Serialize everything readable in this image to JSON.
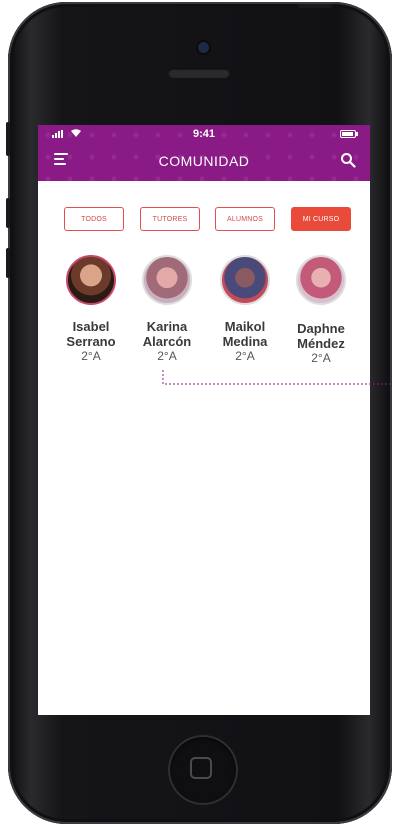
{
  "status_bar": {
    "time": "9:41"
  },
  "header": {
    "title": "COMUNIDAD",
    "menu_icon": "hamburger-menu-icon",
    "search_icon": "search-icon",
    "color": "#8a1a86"
  },
  "filters": [
    {
      "label": "TODOS",
      "active": false
    },
    {
      "label": "TUTORES",
      "active": false
    },
    {
      "label": "ALUMNOS",
      "active": false
    },
    {
      "label": "MI CURSO",
      "active": true
    }
  ],
  "members": [
    {
      "first": "Isabel",
      "last": "Serrano",
      "grade": "2°A"
    },
    {
      "first": "Karina",
      "last": "Alarcón",
      "grade": "2°A"
    },
    {
      "first": "Maikol",
      "last": "Medina",
      "grade": "2°A"
    },
    {
      "first": "Daphne",
      "last": "Méndez",
      "grade": "2°A"
    }
  ],
  "accent_color": "#ea4a3a"
}
